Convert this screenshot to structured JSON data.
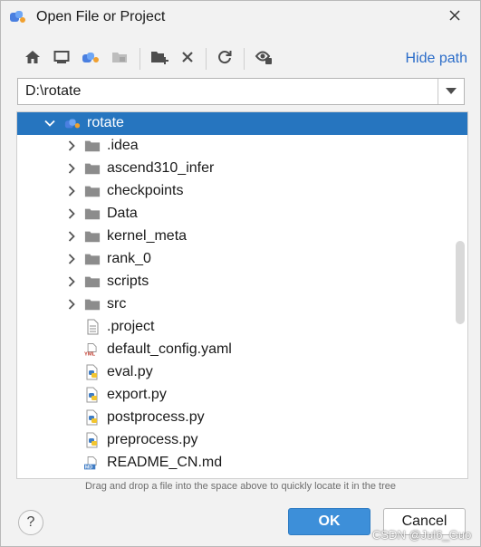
{
  "window": {
    "title": "Open File or Project",
    "close_icon": "close-icon"
  },
  "toolbar": {
    "icons": [
      "home-icon",
      "desktop-icon",
      "project-icon",
      "module-icon",
      "new-folder-icon",
      "delete-icon",
      "refresh-icon",
      "show-hidden-icon"
    ],
    "hide_path_label": "Hide path"
  },
  "path": {
    "value": "D:\\rotate"
  },
  "tree": {
    "items": [
      {
        "label": "rotate",
        "kind": "project-folder",
        "expanded": true,
        "selected": true
      },
      {
        "label": ".idea",
        "kind": "folder"
      },
      {
        "label": "ascend310_infer",
        "kind": "folder"
      },
      {
        "label": "checkpoints",
        "kind": "folder"
      },
      {
        "label": "Data",
        "kind": "folder"
      },
      {
        "label": "kernel_meta",
        "kind": "folder"
      },
      {
        "label": "rank_0",
        "kind": "folder"
      },
      {
        "label": "scripts",
        "kind": "folder"
      },
      {
        "label": "src",
        "kind": "folder"
      },
      {
        "label": ".project",
        "kind": "text-file"
      },
      {
        "label": "default_config.yaml",
        "kind": "yaml-file",
        "badge": "YML"
      },
      {
        "label": "eval.py",
        "kind": "python-file"
      },
      {
        "label": "export.py",
        "kind": "python-file"
      },
      {
        "label": "postprocess.py",
        "kind": "python-file"
      },
      {
        "label": "preprocess.py",
        "kind": "python-file"
      },
      {
        "label": "README_CN.md",
        "kind": "markdown-file",
        "badge": "MD"
      }
    ]
  },
  "hint": "Drag and drop a file into the space above to quickly locate it in the tree",
  "buttons": {
    "help": "?",
    "ok": "OK",
    "cancel": "Cancel"
  },
  "watermark": "CSDN @Jul6_Guo",
  "colors": {
    "selection": "#2675bf",
    "link": "#2d6ec9",
    "ok_button": "#3d8fd9",
    "folder": "#8c8c8c"
  }
}
